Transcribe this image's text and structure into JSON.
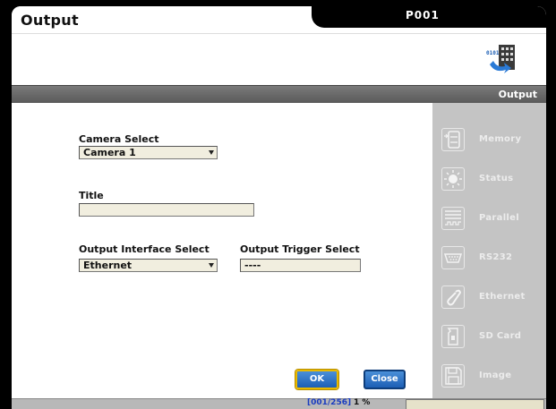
{
  "window": {
    "title": "Output",
    "program": "P001"
  },
  "section": {
    "title": "Output"
  },
  "form": {
    "camera_select": {
      "label": "Camera Select",
      "value": "Camera 1"
    },
    "title_field": {
      "label": "Title",
      "value": ""
    },
    "output_interface": {
      "label": "Output Interface Select",
      "value": "Ethernet"
    },
    "output_trigger": {
      "label": "Output Trigger Select",
      "value": "----"
    }
  },
  "buttons": {
    "ok": "OK",
    "close": "Close"
  },
  "sidebar": {
    "items": [
      {
        "label": "Memory",
        "icon": "memory-icon"
      },
      {
        "label": "Status",
        "icon": "status-light-icon"
      },
      {
        "label": "Parallel",
        "icon": "parallel-icon"
      },
      {
        "label": "RS232",
        "icon": "rs232-icon"
      },
      {
        "label": "Ethernet",
        "icon": "ethernet-icon"
      },
      {
        "label": "SD Card",
        "icon": "sd-card-icon"
      },
      {
        "label": "Image",
        "icon": "floppy-disk-icon"
      }
    ]
  },
  "status": {
    "count": "[001/256]",
    "percent": "1 %"
  },
  "colors": {
    "accent_blue": "#1d5fb5",
    "ok_highlight": "#e8b800",
    "side_panel": "#c4c4c4",
    "field_bg": "#f1eedf"
  }
}
